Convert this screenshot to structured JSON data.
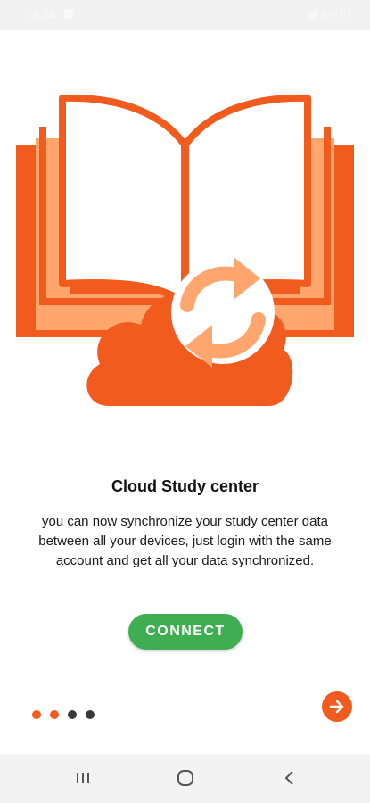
{
  "statusbar": {
    "time": "16:34",
    "battery": "6%"
  },
  "illustration": {
    "icon": "book-cloud-sync-icon"
  },
  "content": {
    "title": "Cloud Study center",
    "description": "you can now synchronize your study center data between all your devices, just login with the same account and get all your data synchronized."
  },
  "connect_label": "CONNECT",
  "pager": {
    "dots": [
      "#f25b1e",
      "#f25b1e",
      "#3a3a3a",
      "#3a3a3a"
    ],
    "current": 2,
    "total": 4
  },
  "colors": {
    "accent": "#f25b1e",
    "accent_light": "#ffa66e",
    "primary_button": "#3fae52"
  }
}
